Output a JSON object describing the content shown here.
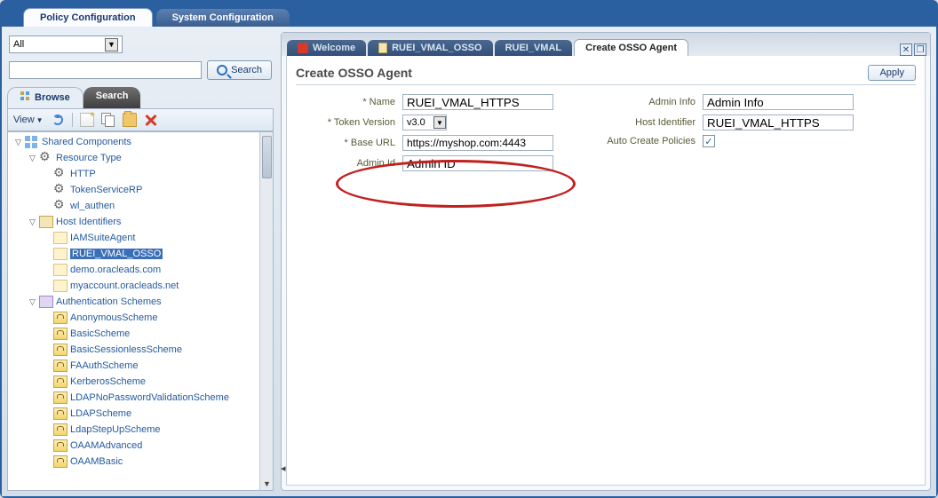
{
  "topTabs": {
    "policy": "Policy Configuration",
    "system": "System Configuration"
  },
  "filter": {
    "scope": "All",
    "searchBtn": "Search"
  },
  "subTabs": {
    "browse": "Browse",
    "search": "Search"
  },
  "toolbar": {
    "view": "View"
  },
  "tree": [
    {
      "d": 0,
      "exp": "▽",
      "icon": "nic-root",
      "label": "Shared Components"
    },
    {
      "d": 1,
      "exp": "▽",
      "icon": "nic-gear",
      "label": "Resource Type"
    },
    {
      "d": 2,
      "exon": "",
      "icon": "nic-gear",
      "label": "HTTP"
    },
    {
      "d": 2,
      "exon": "",
      "icon": "nic-gear",
      "label": "TokenServiceRP"
    },
    {
      "d": 2,
      "exon": "",
      "icon": "nic-gear",
      "label": "wl_authen"
    },
    {
      "d": 1,
      "exp": "▽",
      "icon": "nic-host",
      "label": "Host Identifiers"
    },
    {
      "d": 2,
      "exon": "",
      "icon": "nic-leaf",
      "label": "IAMSuiteAgent"
    },
    {
      "d": 2,
      "exon": "",
      "icon": "nic-leaf",
      "label": "RUEI_VMAL_OSSO",
      "selected": true
    },
    {
      "d": 2,
      "exon": "",
      "icon": "nic-leaf",
      "label": "demo.oracleads.com"
    },
    {
      "d": 2,
      "exon": "",
      "icon": "nic-leaf",
      "label": "myaccount.oracleads.net"
    },
    {
      "d": 1,
      "exp": "▽",
      "icon": "nic-auth",
      "label": "Authentication Schemes"
    },
    {
      "d": 2,
      "exon": "",
      "icon": "nic-scheme",
      "label": "AnonymousScheme"
    },
    {
      "d": 2,
      "exon": "",
      "icon": "nic-scheme",
      "label": "BasicScheme"
    },
    {
      "d": 2,
      "exon": "",
      "icon": "nic-scheme",
      "label": "BasicSessionlessScheme"
    },
    {
      "d": 2,
      "exon": "",
      "icon": "nic-scheme",
      "label": "FAAuthScheme"
    },
    {
      "d": 2,
      "exon": "",
      "icon": "nic-scheme",
      "label": "KerberosScheme"
    },
    {
      "d": 2,
      "exon": "",
      "icon": "nic-scheme",
      "label": "LDAPNoPasswordValidationScheme"
    },
    {
      "d": 2,
      "exon": "",
      "icon": "nic-scheme",
      "label": "LDAPScheme"
    },
    {
      "d": 2,
      "exon": "",
      "icon": "nic-scheme",
      "label": "LdapStepUpScheme"
    },
    {
      "d": 2,
      "exon": "",
      "icon": "nic-scheme",
      "label": "OAAMAdvanced"
    },
    {
      "d": 2,
      "exon": "",
      "icon": "nic-scheme",
      "label": "OAAMBasic"
    }
  ],
  "docTabs": {
    "welcome": "Welcome",
    "osso": "RUEI_VMAL_OSSO",
    "vmal": "RUEI_VMAL",
    "create": "Create OSSO Agent"
  },
  "page": {
    "heading": "Create OSSO Agent",
    "apply": "Apply",
    "fields": {
      "nameLabel": "Name",
      "nameValue": "RUEI_VMAL_HTTPS",
      "tokenLabel": "Token Version",
      "tokenValue": "v3.0",
      "baseUrlLabel": "Base URL",
      "baseUrlValue": "https://myshop.com:4443",
      "adminIdLabel": "Admin Id",
      "adminIdValue": "Admin ID",
      "adminInfoLabel": "Admin Info",
      "adminInfoValue": "Admin Info",
      "hostIdLabel": "Host Identifier",
      "hostIdValue": "RUEI_VMAL_HTTPS",
      "autoCreateLabel": "Auto Create Policies",
      "autoCreateChecked": "✓"
    }
  }
}
